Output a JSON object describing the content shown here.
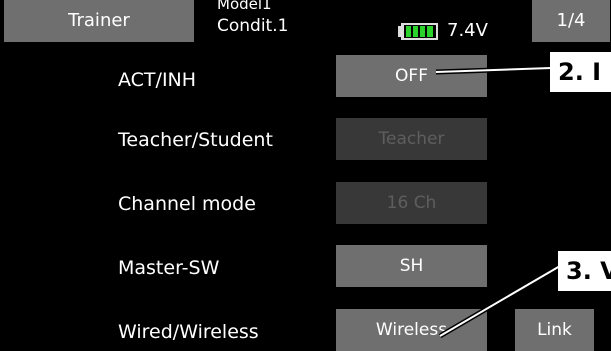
{
  "header": {
    "title": "Trainer",
    "model_name": "Model1",
    "condition": "Condit.1",
    "battery_icon": "battery-icon",
    "battery_color": "#2bd22b",
    "voltage": "7.4V",
    "page": "1/4"
  },
  "rows": [
    {
      "label": "ACT/INH",
      "value": "OFF",
      "enabled": true
    },
    {
      "label": "Teacher/Student",
      "value": "Teacher",
      "enabled": false
    },
    {
      "label": "Channel mode",
      "value": "16 Ch",
      "enabled": false
    },
    {
      "label": "Master-SW",
      "value": "SH",
      "enabled": true
    },
    {
      "label": "Wired/Wireless",
      "value": "Wireless",
      "enabled": true
    }
  ],
  "link_label": "Link",
  "callouts": [
    {
      "text": "2. I"
    },
    {
      "text": "3. V"
    }
  ]
}
